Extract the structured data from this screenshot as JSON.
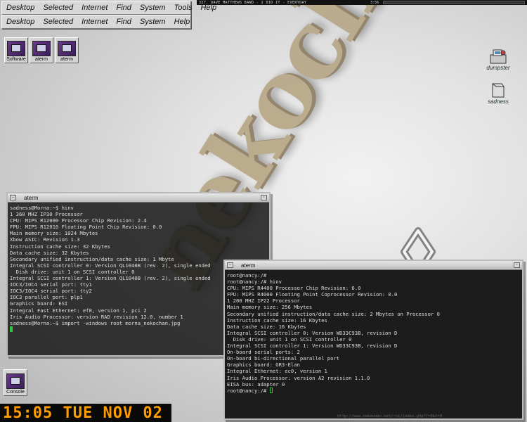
{
  "menubar1": {
    "items": [
      "Desktop",
      "Selected",
      "Internet",
      "Find",
      "System",
      "Tools",
      "Help"
    ]
  },
  "menubar2": {
    "items": [
      "Desktop",
      "Selected",
      "Internet",
      "Find",
      "System",
      "Help"
    ]
  },
  "statusbar": {
    "song": "327. DAVE MATTHEWS BAND - I DID IT - EVERYDAY",
    "time": "3:56",
    "progress": 0.0
  },
  "background": {
    "word": "nekochan"
  },
  "launcher": {
    "items": [
      "Software",
      "aterm",
      "aterm"
    ]
  },
  "desktop_icons": {
    "dumpster": "dumpster",
    "sadness": "sadness"
  },
  "aterm1": {
    "title": "aterm",
    "lines": [
      "sadness@Morna:~$ hinv",
      "1 360 MHZ IP30 Processor",
      "CPU: MIPS R12000 Processor Chip Revision: 2.4",
      "FPU: MIPS R12010 Floating Point Chip Revision: 0.0",
      "Main memory size: 1024 Mbytes",
      "Xbow ASIC: Revision 1.3",
      "Instruction cache size: 32 Kbytes",
      "Data cache size: 32 Kbytes",
      "Secondary unified instruction/data cache size: 1 Mbyte",
      "Integral SCSI controller 0: Version QL1040B (rev. 2), single ended",
      "  Disk drive: unit 1 on SCSI controller 0",
      "Integral SCSI controller 1: Version QL1040B (rev. 2), single ended",
      "IOC3/IOC4 serial port: tty1",
      "IOC3/IOC4 serial port: tty2",
      "IOC3 parallel port: plp1",
      "Graphics board: ESI",
      "Integral Fast Ethernet: ef0, version 1, pci 2",
      "Iris Audio Processor: version RAD revision 12.0, number 1",
      "sadness@Morna:~$ import -windows root morna_nekochan.jpg"
    ]
  },
  "aterm2": {
    "title": "aterm",
    "lines": [
      "root@nancy:/#",
      "root@nancy:/# hinv",
      "CPU: MIPS R4400 Processor Chip Revision: 6.0",
      "FPU: MIPS R4000 Floating Point Coprocessor Revision: 0.0",
      "1 200 MHZ IP22 Processor",
      "Main memory size: 256 Mbytes",
      "Secondary unified instruction/data cache size: 2 Mbytes on Processor 0",
      "Instruction cache size: 16 Kbytes",
      "Data cache size: 16 Kbytes",
      "Integral SCSI controller 0: Version WD33C93B, revision D",
      "  Disk drive: unit 1 on SCSI controller 0",
      "Integral SCSI controller 1: Version WD33C93B, revision D",
      "On-board serial ports: 2",
      "On-board bi-directional parallel port",
      "Graphics board: GR3-Elan",
      "Integral Ethernet: ec0, version 1",
      "Iris Audio Processor: version A2 revision 1.1.0",
      "EISA bus: adapter 0",
      "root@nancy:/# "
    ]
  },
  "console": {
    "label": "Console"
  },
  "clock": {
    "text": "15:05 TUE NOV 02"
  },
  "footer": {
    "url": "http://www.nekochan.net/~ni/index.php?f=0&t=0"
  }
}
